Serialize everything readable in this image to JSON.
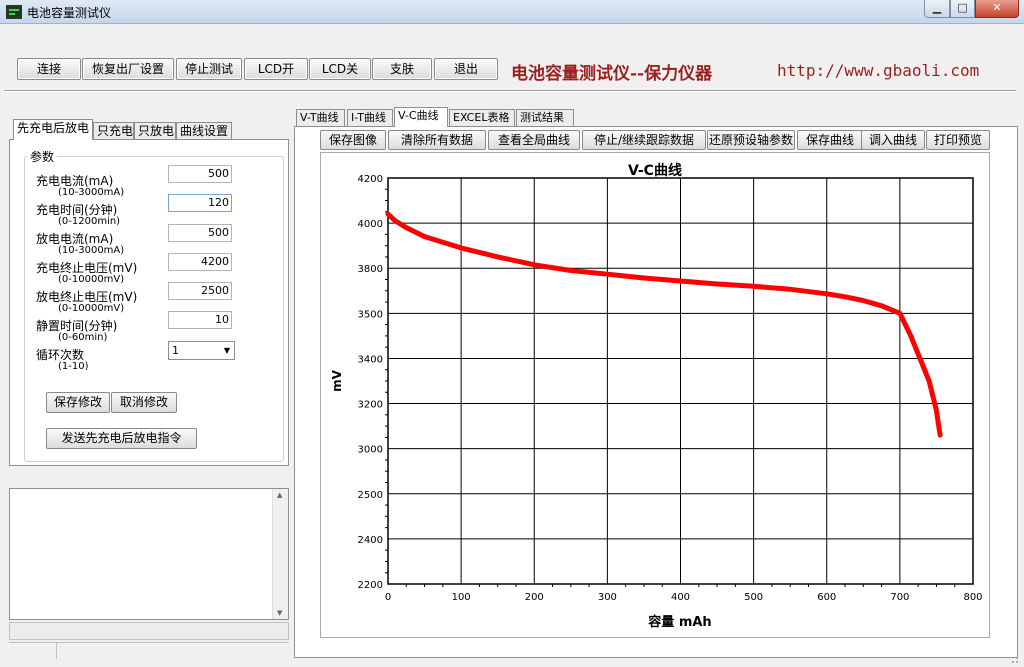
{
  "window": {
    "title": "电池容量测试仪",
    "minimize": "▁",
    "maximize": "□",
    "close": "✕"
  },
  "toolbar": {
    "buttons": [
      "连接",
      "恢复出厂设置",
      "停止测试",
      "LCD开",
      "LCD关",
      "支肤",
      "退出"
    ],
    "brand": "电池容量测试仪--保力仪器",
    "url": "http://www.gbaoli.com"
  },
  "left_tabs": [
    "先充电后放电",
    "只充电",
    "只放电",
    "曲线设置"
  ],
  "params": {
    "group_title": "参数",
    "items": [
      {
        "label": "充电电流(mA)",
        "range": "(10-3000mA)",
        "value": "500"
      },
      {
        "label": "充电时间(分钟)",
        "range": "(0-1200min)",
        "value": "120"
      },
      {
        "label": "放电电流(mA)",
        "range": "(10-3000mA)",
        "value": "500"
      },
      {
        "label": "充电终止电压(mV)",
        "range": "(0-10000mV)",
        "value": "4200"
      },
      {
        "label": "放电终止电压(mV)",
        "range": "(0-10000mV)",
        "value": "2500"
      },
      {
        "label": "静置时间(分钟)",
        "range": "(0-60min)",
        "value": "10"
      },
      {
        "label": "循环次数",
        "range": "(1-10)",
        "value": "1"
      }
    ],
    "save_label": "保存修改",
    "cancel_label": "取消修改",
    "send_label": "发送先充电后放电指令"
  },
  "right_tabs": [
    "V-T曲线",
    "I-T曲线",
    "V-C曲线",
    "EXCEL表格",
    "测试结果"
  ],
  "chart_buttons": [
    "保存图像",
    "清除所有数据",
    "查看全局曲线",
    "停止/继续跟踪数据",
    "还原预设轴参数",
    "保存曲线",
    "调入曲线",
    "打印预览"
  ],
  "chart_data": {
    "type": "line",
    "title": "V-C曲线",
    "xlabel": "容量 mAh",
    "ylabel": "mV",
    "xlim": [
      0,
      800
    ],
    "ylim": [
      2200,
      4300
    ],
    "x_ticks": [
      0,
      100,
      200,
      300,
      400,
      500,
      600,
      700,
      800
    ],
    "y_ticks": [
      2200,
      2400,
      2500,
      3000,
      3200,
      3400,
      3500,
      3800,
      4000,
      4200
    ],
    "y_tick_labels": [
      "2200",
      "2400",
      "2500",
      "3000",
      "3200",
      "3400",
      "3500",
      "3800",
      "4000",
      "4200"
    ],
    "color": "#ff0000",
    "grid": true,
    "series": [
      {
        "x": [
          0,
          10,
          25,
          50,
          75,
          100,
          150,
          200,
          250,
          300,
          350,
          400,
          450,
          500,
          550,
          600,
          625,
          650,
          675,
          700,
          715,
          730,
          740,
          750,
          755
        ],
        "y": [
          4040,
          4010,
          3980,
          3940,
          3915,
          3890,
          3850,
          3815,
          3785,
          3760,
          3735,
          3715,
          3695,
          3680,
          3660,
          3630,
          3610,
          3585,
          3550,
          3500,
          3450,
          3380,
          3300,
          3170,
          3060
        ]
      }
    ]
  }
}
